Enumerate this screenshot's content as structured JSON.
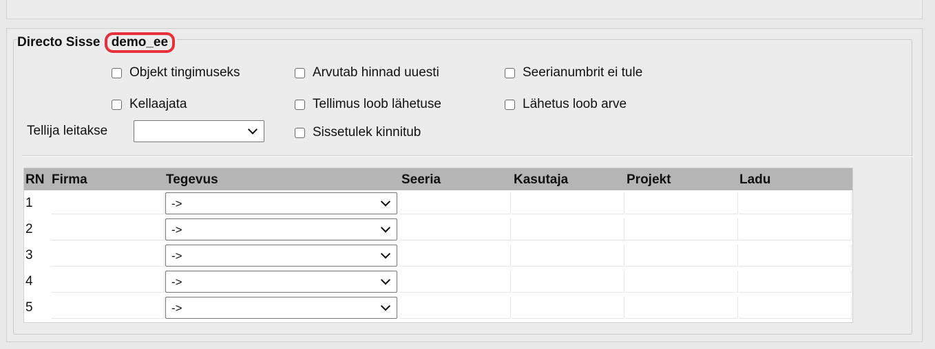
{
  "legend": {
    "title": "Directo Sisse",
    "user": "demo_ee"
  },
  "options": {
    "objekt_tingimuseks": "Objekt tingimuseks",
    "arvutab_hinnad_uuesti": "Arvutab hinnad uuesti",
    "seerianumbrit_ei_tule": "Seerianumbrit ei tule",
    "kellaajata": "Kellaajata",
    "tellimus_loob_lahetuse": "Tellimus loob lähetuse",
    "lahetus_loob_arve": "Lähetus loob arve",
    "sissetulek_kinnitub": "Sissetulek kinnitub"
  },
  "tellija": {
    "label": "Tellija leitakse",
    "value": ""
  },
  "table": {
    "headers": {
      "rn": "RN",
      "firma": "Firma",
      "tegevus": "Tegevus",
      "seeria": "Seeria",
      "kasutaja": "Kasutaja",
      "projekt": "Projekt",
      "ladu": "Ladu"
    },
    "rows": [
      {
        "rn": "1",
        "tegevus": "->"
      },
      {
        "rn": "2",
        "tegevus": "->"
      },
      {
        "rn": "3",
        "tegevus": "->"
      },
      {
        "rn": "4",
        "tegevus": "->"
      },
      {
        "rn": "5",
        "tegevus": "->"
      }
    ]
  }
}
